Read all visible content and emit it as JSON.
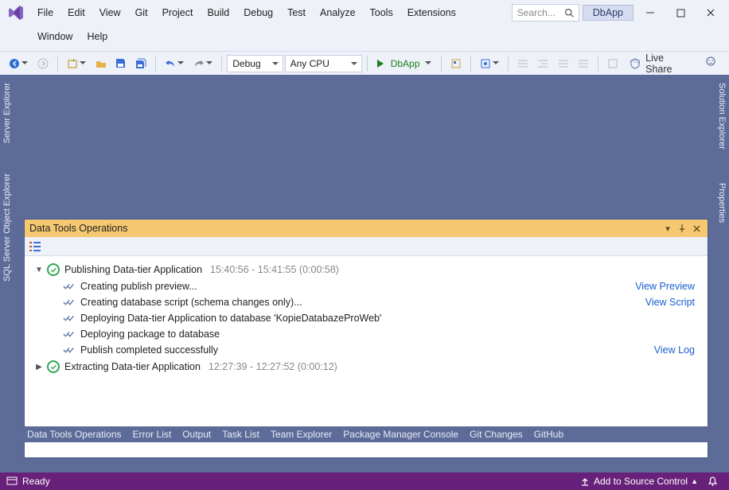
{
  "solution_name": "DbApp",
  "search_placeholder": "Search...",
  "menu": {
    "row1": [
      "File",
      "Edit",
      "View",
      "Git",
      "Project",
      "Build",
      "Debug",
      "Test",
      "Analyze",
      "Tools",
      "Extensions"
    ],
    "row2": [
      "Window",
      "Help"
    ]
  },
  "toolbar": {
    "config": "Debug",
    "platform": "Any CPU",
    "start_target": "DbApp",
    "live_share": "Live Share"
  },
  "left_tabs": [
    "Server Explorer",
    "SQL Server Object Explorer"
  ],
  "right_tabs": [
    "Solution Explorer",
    "Properties"
  ],
  "panel": {
    "title": "Data Tools Operations",
    "ops": [
      {
        "expanded": true,
        "title": "Publishing Data-tier Application",
        "time": "15:40:56 - 15:41:55 (0:00:58)",
        "steps": [
          {
            "text": "Creating publish preview...",
            "link": "View Preview"
          },
          {
            "text": "Creating database script (schema changes only)...",
            "link": "View Script"
          },
          {
            "text": "Deploying Data-tier Application to database 'KopieDatabazeProWeb'",
            "link": ""
          },
          {
            "text": "Deploying package to database",
            "link": ""
          },
          {
            "text": "Publish completed successfully",
            "link": "View Log"
          }
        ]
      },
      {
        "expanded": false,
        "title": "Extracting Data-tier Application",
        "time": "12:27:39 - 12:27:52 (0:00:12)",
        "steps": []
      }
    ]
  },
  "bottom_tabs": [
    "Data Tools Operations",
    "Error List",
    "Output",
    "Task List",
    "Team Explorer",
    "Package Manager Console",
    "Git Changes",
    "GitHub"
  ],
  "status": {
    "ready": "Ready",
    "source_control": "Add to Source Control"
  }
}
